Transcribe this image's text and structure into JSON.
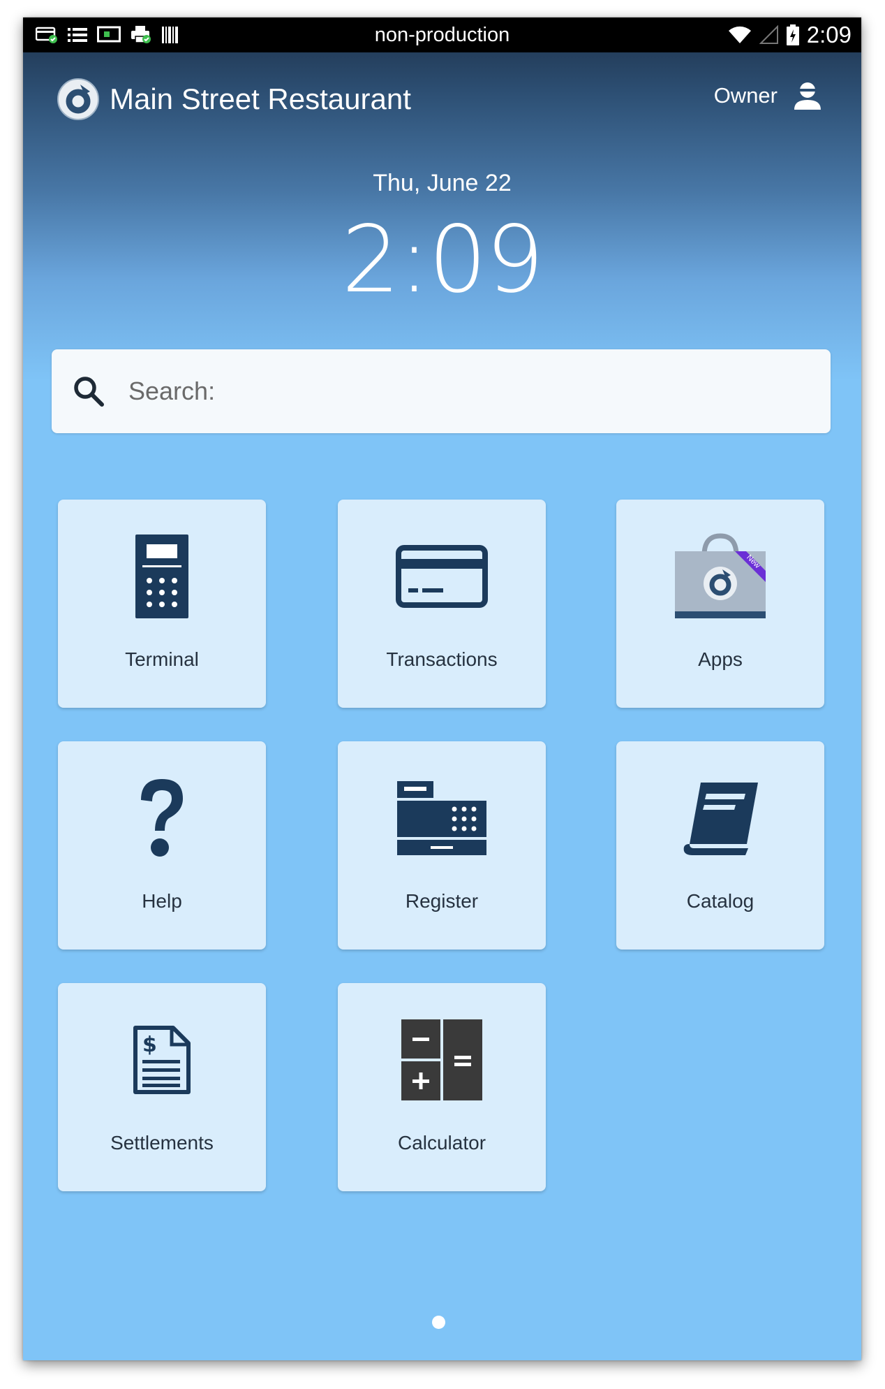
{
  "status_bar": {
    "environment": "non-production",
    "time": "2:09",
    "icons": [
      "card-reader-icon",
      "list-icon",
      "display-icon",
      "printer-icon",
      "barcode-icon",
      "wifi-icon",
      "signal-icon",
      "battery-icon"
    ]
  },
  "header": {
    "title": "Main Street Restaurant",
    "user_label": "Owner",
    "logo": "clover-logo-icon",
    "user_icon": "user-icon"
  },
  "clock": {
    "date": "Thu, June 22",
    "time": "2:09"
  },
  "search": {
    "placeholder": "Search:",
    "value": ""
  },
  "tiles": [
    {
      "label": "Terminal",
      "icon": "terminal-icon"
    },
    {
      "label": "Transactions",
      "icon": "credit-card-icon"
    },
    {
      "label": "Apps",
      "icon": "app-market-icon",
      "badge": "New"
    },
    {
      "label": "Help",
      "icon": "question-icon"
    },
    {
      "label": "Register",
      "icon": "cash-register-icon"
    },
    {
      "label": "Catalog",
      "icon": "book-icon"
    },
    {
      "label": "Settlements",
      "icon": "document-dollar-icon"
    },
    {
      "label": "Calculator",
      "icon": "calculator-icon"
    }
  ],
  "pager": {
    "pages": 1,
    "current": 1
  },
  "colors": {
    "background": "#7fc4f7",
    "tile": "#d9edfc",
    "icon_dark": "#1b3a5b",
    "badge": "#6b2fd6"
  }
}
